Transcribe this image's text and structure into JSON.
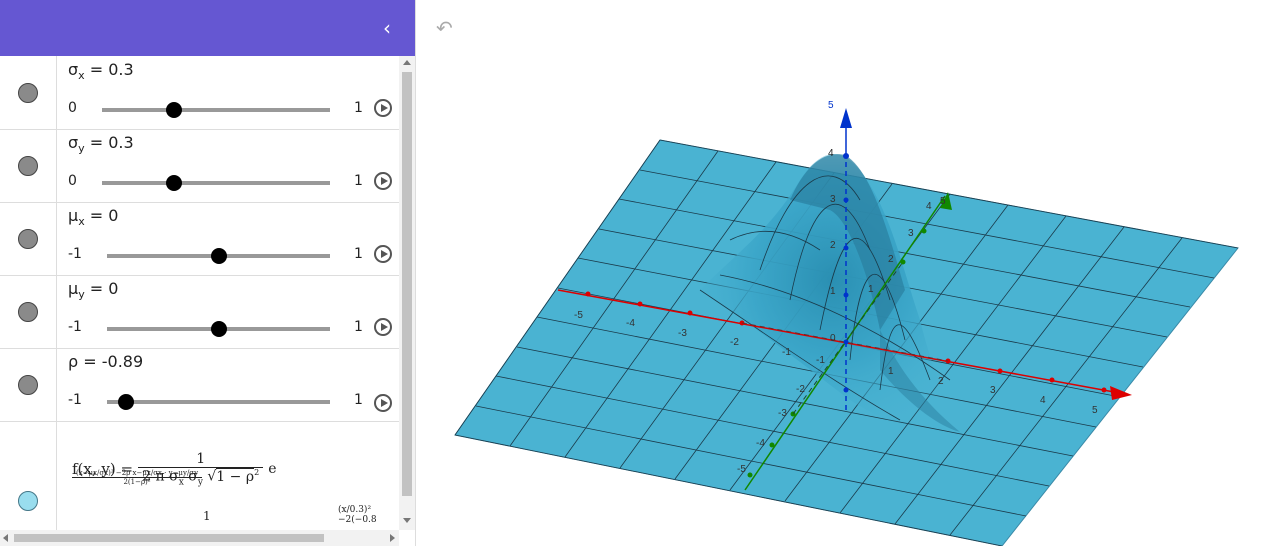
{
  "algebra": {
    "collapse_icon": "chevron-left-icon",
    "sliders": [
      {
        "base": "σ",
        "sub": "x",
        "value": "0.3",
        "min": "0",
        "max": "1",
        "fraction": 0.3
      },
      {
        "base": "σ",
        "sub": "y",
        "value": "0.3",
        "min": "0",
        "max": "1",
        "fraction": 0.3
      },
      {
        "base": "μ",
        "sub": "x",
        "value": "0",
        "min": "-1",
        "max": "1",
        "fraction": 0.5
      },
      {
        "base": "μ",
        "sub": "y",
        "value": "0",
        "min": "-1",
        "max": "1",
        "fraction": 0.5
      },
      {
        "base": "ρ",
        "sub": "",
        "value": "-0.89",
        "min": "-1",
        "max": "1",
        "fraction": 0.055
      }
    ],
    "function": {
      "lhs": "f(x, y) =",
      "numerator": "1",
      "denominator_pre": "2 π σ",
      "sub_x": "x",
      "sigma": "σ",
      "sub_y": "y",
      "sqrt_content": "1 − ρ",
      "power": "2",
      "e": "e",
      "exp_num": "(x−μx/σx)² −2ρ x−μx/σx · y−μy/σy",
      "exp_den": "2(1−ρ)²",
      "next_numerator": "1",
      "next_exp": "(x/0.3)² −2(−0.8"
    }
  },
  "graphics": {
    "undo_icon": "undo-icon",
    "z_label_top": "5",
    "z_label_4": "4",
    "x_ticks": [
      "-5",
      "-4",
      "-3",
      "-2",
      "-1",
      "1",
      "2",
      "3",
      "4",
      "5"
    ],
    "y_ticks": [
      "-5",
      "-4",
      "-3",
      "-2",
      "-1",
      "1",
      "2",
      "3",
      "4",
      "5"
    ],
    "z_ticks": [
      "1",
      "2",
      "3"
    ],
    "origin": "0",
    "colors": {
      "surface": "#4ab3d2",
      "grid": "#1a3a4a",
      "x_axis": "#dd0000",
      "y_axis": "#118800",
      "z_axis": "#0033cc"
    }
  }
}
